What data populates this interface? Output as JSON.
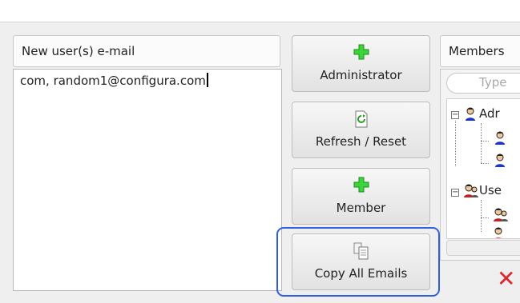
{
  "email_panel": {
    "header": "New user(s) e-mail",
    "value": "com, random1@configura.com"
  },
  "buttons": {
    "administrator": "Administrator",
    "refresh": "Refresh / Reset",
    "member": "Member",
    "copy_emails": "Copy All Emails"
  },
  "members_panel": {
    "header": "Members",
    "search_placeholder": "Type",
    "groups": [
      {
        "label": "Adr",
        "icon": "admin-user-icon"
      },
      {
        "label": "Use",
        "icon": "users-group-icon"
      }
    ]
  },
  "colors": {
    "focus_ring": "#2f5fe0",
    "plus_icon": "#3bd53b",
    "delete_icon": "#e0242b",
    "admin_blue": "#1b33c9",
    "user_red": "#c81e1e"
  },
  "icons": [
    "plus-icon",
    "refresh-icon",
    "copy-icon",
    "delete-x-icon",
    "expand-icon",
    "admin-user-icon",
    "users-group-icon"
  ]
}
